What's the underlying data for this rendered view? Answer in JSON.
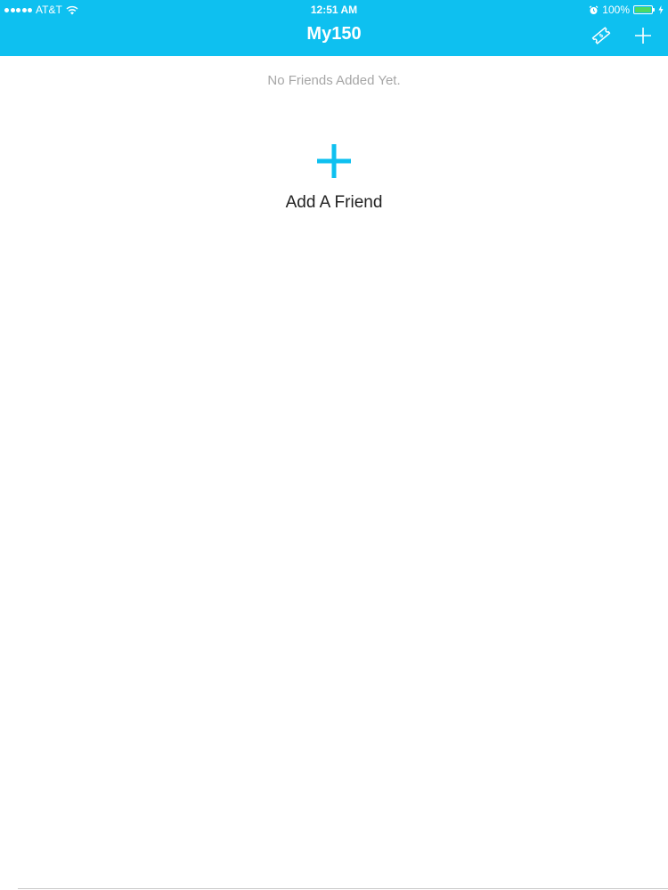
{
  "status_bar": {
    "carrier": "AT&T",
    "time": "12:51 AM",
    "battery_percent": "100%",
    "icons": [
      "signal-dots-icon",
      "wifi-icon",
      "alarm-icon",
      "battery-icon",
      "charging-bolt-icon"
    ]
  },
  "nav": {
    "title": "My150",
    "left_action_icon": "ticket-icon",
    "right_action_icon": "plus-icon",
    "bar_color": "#0ec0f0"
  },
  "main": {
    "empty_message": "No Friends Added Yet.",
    "add_friend_label": "Add A Friend",
    "add_icon": "big-plus-icon",
    "accent_color": "#0ec0f0"
  }
}
